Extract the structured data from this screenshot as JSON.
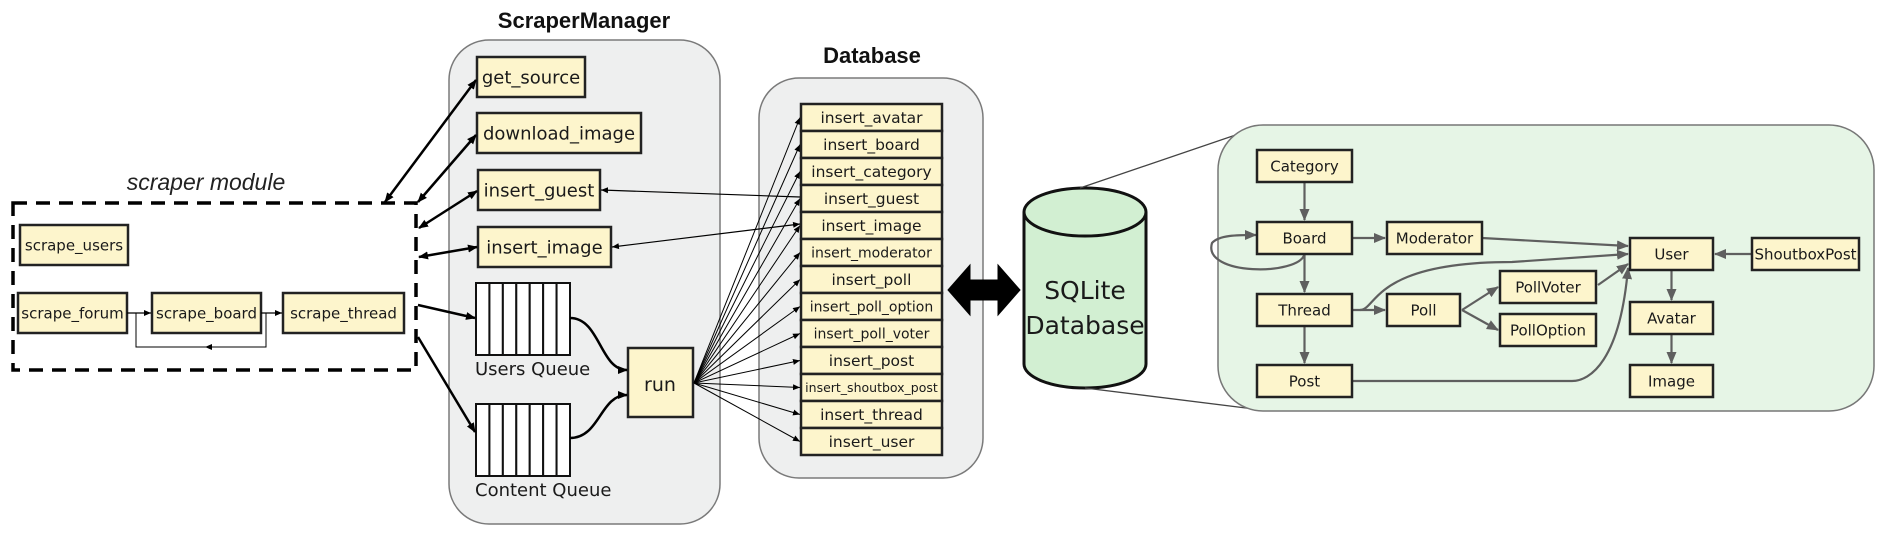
{
  "colors": {
    "box_fill": "#fdf5cc",
    "box_stroke": "#222222",
    "panel_fill": "#eeefef",
    "panel_stroke": "#7a7a7a",
    "er_panel_fill": "#e6f5e6",
    "cylinder_fill": "#d2efd2",
    "er_arrow": "#5f5f5f",
    "arrow": "#000000"
  },
  "scraper_module": {
    "title": "scraper module",
    "functions": [
      {
        "id": "scrape_users",
        "label": "scrape_users"
      },
      {
        "id": "scrape_forum",
        "label": "scrape_forum"
      },
      {
        "id": "scrape_board",
        "label": "scrape_board"
      },
      {
        "id": "scrape_thread",
        "label": "scrape_thread"
      }
    ]
  },
  "scraper_manager": {
    "title": "ScraperManager",
    "methods": [
      {
        "id": "get_source",
        "label": "get_source"
      },
      {
        "id": "download_image",
        "label": "download_image"
      },
      {
        "id": "insert_guest",
        "label": "insert_guest"
      },
      {
        "id": "insert_image",
        "label": "insert_image"
      }
    ],
    "queues": [
      {
        "id": "users_queue",
        "label": "Users Queue",
        "slots": 7
      },
      {
        "id": "content_queue",
        "label": "Content Queue",
        "slots": 7
      }
    ],
    "run_label": "run"
  },
  "database": {
    "title": "Database",
    "methods": [
      "insert_avatar",
      "insert_board",
      "insert_category",
      "insert_guest",
      "insert_image",
      "insert_moderator",
      "insert_poll",
      "insert_poll_option",
      "insert_poll_voter",
      "insert_post",
      "insert_shoutbox_post",
      "insert_thread",
      "insert_user"
    ]
  },
  "sqlite": {
    "line1": "SQLite",
    "line2": "Database"
  },
  "er_model": {
    "entities": [
      {
        "id": "Category",
        "label": "Category"
      },
      {
        "id": "Board",
        "label": "Board"
      },
      {
        "id": "Moderator",
        "label": "Moderator"
      },
      {
        "id": "Thread",
        "label": "Thread"
      },
      {
        "id": "Poll",
        "label": "Poll"
      },
      {
        "id": "PollVoter",
        "label": "PollVoter"
      },
      {
        "id": "PollOption",
        "label": "PollOption"
      },
      {
        "id": "Post",
        "label": "Post"
      },
      {
        "id": "User",
        "label": "User"
      },
      {
        "id": "ShoutboxPost",
        "label": "ShoutboxPost"
      },
      {
        "id": "Avatar",
        "label": "Avatar"
      },
      {
        "id": "Image",
        "label": "Image"
      }
    ],
    "relations": [
      [
        "Category",
        "Board"
      ],
      [
        "Board",
        "Board"
      ],
      [
        "Board",
        "Moderator"
      ],
      [
        "Board",
        "Thread"
      ],
      [
        "Moderator",
        "User"
      ],
      [
        "Thread",
        "User"
      ],
      [
        "Thread",
        "Poll"
      ],
      [
        "Thread",
        "Post"
      ],
      [
        "Poll",
        "PollVoter"
      ],
      [
        "Poll",
        "PollOption"
      ],
      [
        "PollVoter",
        "User"
      ],
      [
        "Post",
        "User"
      ],
      [
        "ShoutboxPost",
        "User"
      ],
      [
        "User",
        "Avatar"
      ],
      [
        "Avatar",
        "Image"
      ]
    ]
  }
}
